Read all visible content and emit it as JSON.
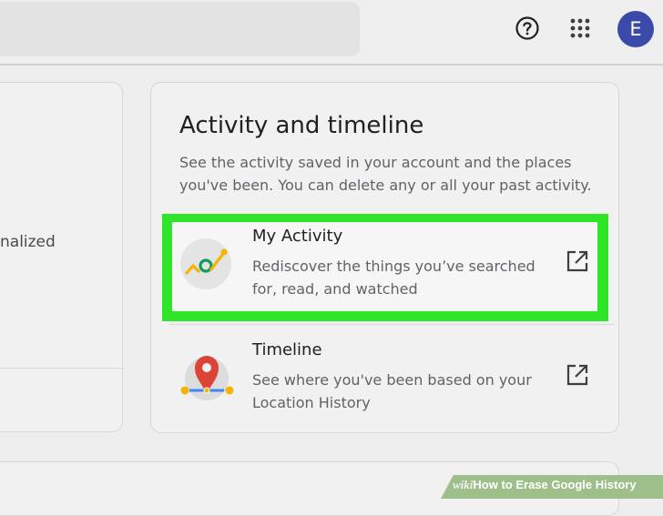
{
  "header": {
    "help_icon": "help-circle-icon",
    "apps_icon": "apps-grid-icon",
    "avatar_letter": "E",
    "avatar_color": "#3b4aa9"
  },
  "left_card": {
    "partial_text": "nalized"
  },
  "activity_card": {
    "title": "Activity and timeline",
    "description": "See the activity saved in your account and the places you've been. You can delete any or all your past activity.",
    "items": [
      {
        "title": "My Activity",
        "description": "Rediscover the things you’ve searched for, read, and watched",
        "icon": "my-activity-icon",
        "action_icon": "open-external-icon",
        "highlighted": true
      },
      {
        "title": "Timeline",
        "description": "See where you've been based on your Location History",
        "icon": "timeline-location-icon",
        "action_icon": "open-external-icon",
        "highlighted": false
      }
    ]
  },
  "colors": {
    "highlight": "#2ee52a",
    "accent_blue": "#3b4aa9"
  },
  "watermark": {
    "brand": "wiki",
    "text": "How to Erase Google History"
  }
}
